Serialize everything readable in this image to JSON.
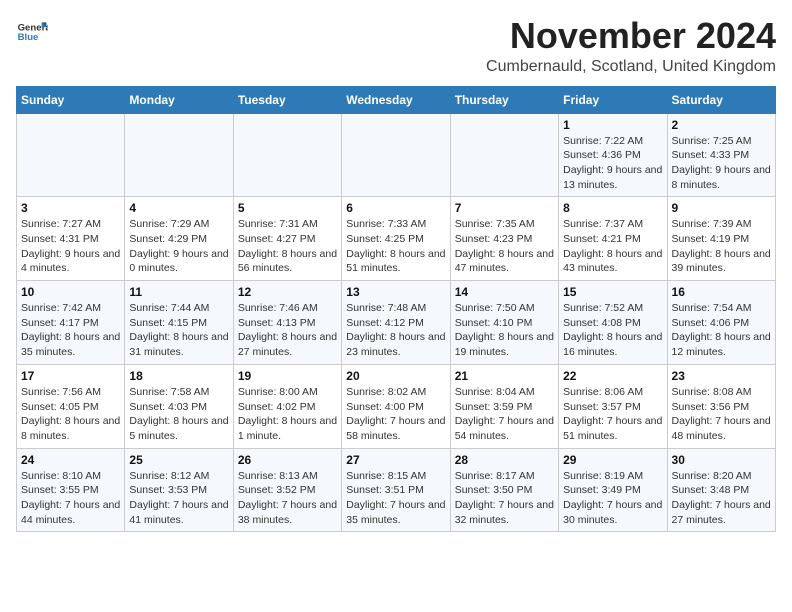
{
  "logo": {
    "general": "General",
    "blue": "Blue"
  },
  "header": {
    "month": "November 2024",
    "location": "Cumbernauld, Scotland, United Kingdom"
  },
  "days_of_week": [
    "Sunday",
    "Monday",
    "Tuesday",
    "Wednesday",
    "Thursday",
    "Friday",
    "Saturday"
  ],
  "weeks": [
    [
      {
        "day": "",
        "info": ""
      },
      {
        "day": "",
        "info": ""
      },
      {
        "day": "",
        "info": ""
      },
      {
        "day": "",
        "info": ""
      },
      {
        "day": "",
        "info": ""
      },
      {
        "day": "1",
        "info": "Sunrise: 7:22 AM\nSunset: 4:36 PM\nDaylight: 9 hours and 13 minutes."
      },
      {
        "day": "2",
        "info": "Sunrise: 7:25 AM\nSunset: 4:33 PM\nDaylight: 9 hours and 8 minutes."
      }
    ],
    [
      {
        "day": "3",
        "info": "Sunrise: 7:27 AM\nSunset: 4:31 PM\nDaylight: 9 hours and 4 minutes."
      },
      {
        "day": "4",
        "info": "Sunrise: 7:29 AM\nSunset: 4:29 PM\nDaylight: 9 hours and 0 minutes."
      },
      {
        "day": "5",
        "info": "Sunrise: 7:31 AM\nSunset: 4:27 PM\nDaylight: 8 hours and 56 minutes."
      },
      {
        "day": "6",
        "info": "Sunrise: 7:33 AM\nSunset: 4:25 PM\nDaylight: 8 hours and 51 minutes."
      },
      {
        "day": "7",
        "info": "Sunrise: 7:35 AM\nSunset: 4:23 PM\nDaylight: 8 hours and 47 minutes."
      },
      {
        "day": "8",
        "info": "Sunrise: 7:37 AM\nSunset: 4:21 PM\nDaylight: 8 hours and 43 minutes."
      },
      {
        "day": "9",
        "info": "Sunrise: 7:39 AM\nSunset: 4:19 PM\nDaylight: 8 hours and 39 minutes."
      }
    ],
    [
      {
        "day": "10",
        "info": "Sunrise: 7:42 AM\nSunset: 4:17 PM\nDaylight: 8 hours and 35 minutes."
      },
      {
        "day": "11",
        "info": "Sunrise: 7:44 AM\nSunset: 4:15 PM\nDaylight: 8 hours and 31 minutes."
      },
      {
        "day": "12",
        "info": "Sunrise: 7:46 AM\nSunset: 4:13 PM\nDaylight: 8 hours and 27 minutes."
      },
      {
        "day": "13",
        "info": "Sunrise: 7:48 AM\nSunset: 4:12 PM\nDaylight: 8 hours and 23 minutes."
      },
      {
        "day": "14",
        "info": "Sunrise: 7:50 AM\nSunset: 4:10 PM\nDaylight: 8 hours and 19 minutes."
      },
      {
        "day": "15",
        "info": "Sunrise: 7:52 AM\nSunset: 4:08 PM\nDaylight: 8 hours and 16 minutes."
      },
      {
        "day": "16",
        "info": "Sunrise: 7:54 AM\nSunset: 4:06 PM\nDaylight: 8 hours and 12 minutes."
      }
    ],
    [
      {
        "day": "17",
        "info": "Sunrise: 7:56 AM\nSunset: 4:05 PM\nDaylight: 8 hours and 8 minutes."
      },
      {
        "day": "18",
        "info": "Sunrise: 7:58 AM\nSunset: 4:03 PM\nDaylight: 8 hours and 5 minutes."
      },
      {
        "day": "19",
        "info": "Sunrise: 8:00 AM\nSunset: 4:02 PM\nDaylight: 8 hours and 1 minute."
      },
      {
        "day": "20",
        "info": "Sunrise: 8:02 AM\nSunset: 4:00 PM\nDaylight: 7 hours and 58 minutes."
      },
      {
        "day": "21",
        "info": "Sunrise: 8:04 AM\nSunset: 3:59 PM\nDaylight: 7 hours and 54 minutes."
      },
      {
        "day": "22",
        "info": "Sunrise: 8:06 AM\nSunset: 3:57 PM\nDaylight: 7 hours and 51 minutes."
      },
      {
        "day": "23",
        "info": "Sunrise: 8:08 AM\nSunset: 3:56 PM\nDaylight: 7 hours and 48 minutes."
      }
    ],
    [
      {
        "day": "24",
        "info": "Sunrise: 8:10 AM\nSunset: 3:55 PM\nDaylight: 7 hours and 44 minutes."
      },
      {
        "day": "25",
        "info": "Sunrise: 8:12 AM\nSunset: 3:53 PM\nDaylight: 7 hours and 41 minutes."
      },
      {
        "day": "26",
        "info": "Sunrise: 8:13 AM\nSunset: 3:52 PM\nDaylight: 7 hours and 38 minutes."
      },
      {
        "day": "27",
        "info": "Sunrise: 8:15 AM\nSunset: 3:51 PM\nDaylight: 7 hours and 35 minutes."
      },
      {
        "day": "28",
        "info": "Sunrise: 8:17 AM\nSunset: 3:50 PM\nDaylight: 7 hours and 32 minutes."
      },
      {
        "day": "29",
        "info": "Sunrise: 8:19 AM\nSunset: 3:49 PM\nDaylight: 7 hours and 30 minutes."
      },
      {
        "day": "30",
        "info": "Sunrise: 8:20 AM\nSunset: 3:48 PM\nDaylight: 7 hours and 27 minutes."
      }
    ]
  ]
}
